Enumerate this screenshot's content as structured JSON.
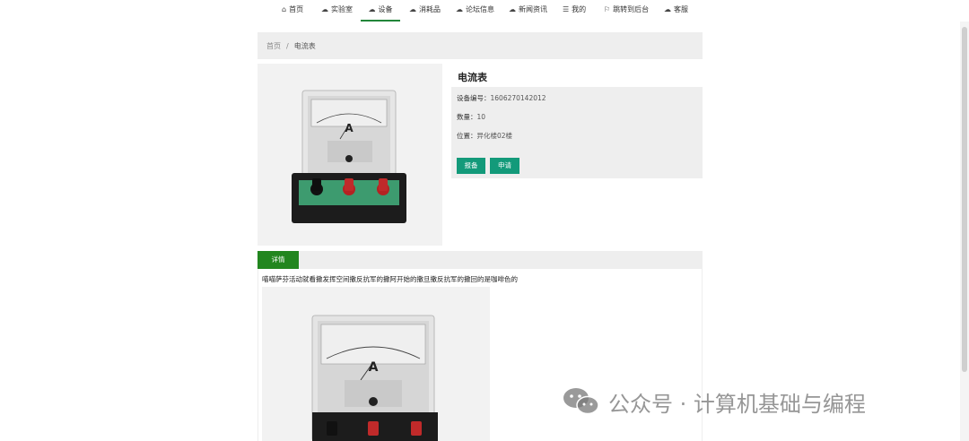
{
  "nav": {
    "items": [
      {
        "icon": "home-icon",
        "glyph": "⌂",
        "label": "首页"
      },
      {
        "icon": "lab-icon",
        "glyph": "☁",
        "label": "实验室"
      },
      {
        "icon": "equipment-icon",
        "glyph": "☁",
        "label": "设备",
        "active": true
      },
      {
        "icon": "consumables-icon",
        "glyph": "☁",
        "label": "消耗品"
      },
      {
        "icon": "forum-icon",
        "glyph": "☁",
        "label": "论坛信息"
      },
      {
        "icon": "news-icon",
        "glyph": "☁",
        "label": "新闻资讯"
      },
      {
        "icon": "mine-icon",
        "glyph": "☰",
        "label": "我的"
      },
      {
        "icon": "flag-icon",
        "glyph": "⚐",
        "label": "跳转到后台"
      },
      {
        "icon": "service-icon",
        "glyph": "☁",
        "label": "客服"
      }
    ]
  },
  "breadcrumb": {
    "home": "首页",
    "separator": "/",
    "current": "电流表"
  },
  "product": {
    "title": "电流表",
    "code_label": "设备编号：",
    "code": "1606270142012",
    "qty_label": "数量：",
    "qty": "10",
    "location_label": "位置：",
    "location": "异化楼02楼",
    "report_button": "报备",
    "apply_button": "申请"
  },
  "details": {
    "tab_label": "详情",
    "text": "喵喵萨芬活动就看撒发挥空间撒反抗军的撒阿开始的撒旦撒反抗军的撒回的是咖啡色的"
  },
  "watermark": {
    "text": "公众号 · 计算机基础与编程"
  },
  "colors": {
    "accent": "#139a7a",
    "tab_green": "#22861f",
    "nav_active": "#22863a"
  }
}
